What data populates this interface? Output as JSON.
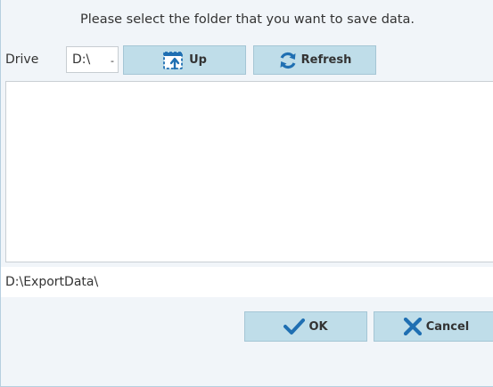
{
  "dialog": {
    "prompt": "Please select the folder that you want to save data."
  },
  "drive": {
    "label": "Drive",
    "selected": "D:\\",
    "arrow": "-"
  },
  "toolbar": {
    "up_label": "Up",
    "up_icon": "folder-up-icon",
    "refresh_label": "Refresh",
    "refresh_icon": "refresh-icon"
  },
  "folder_list": {
    "items": []
  },
  "path": {
    "value": "D:\\ExportData\\"
  },
  "actions": {
    "ok_label": "OK",
    "ok_icon": "checkmark-icon",
    "cancel_label": "Cancel",
    "cancel_icon": "x-icon"
  },
  "colors": {
    "background": "#f1f5f9",
    "button_fill": "#bfdde9",
    "icon_blue": "#1f6fb2"
  }
}
